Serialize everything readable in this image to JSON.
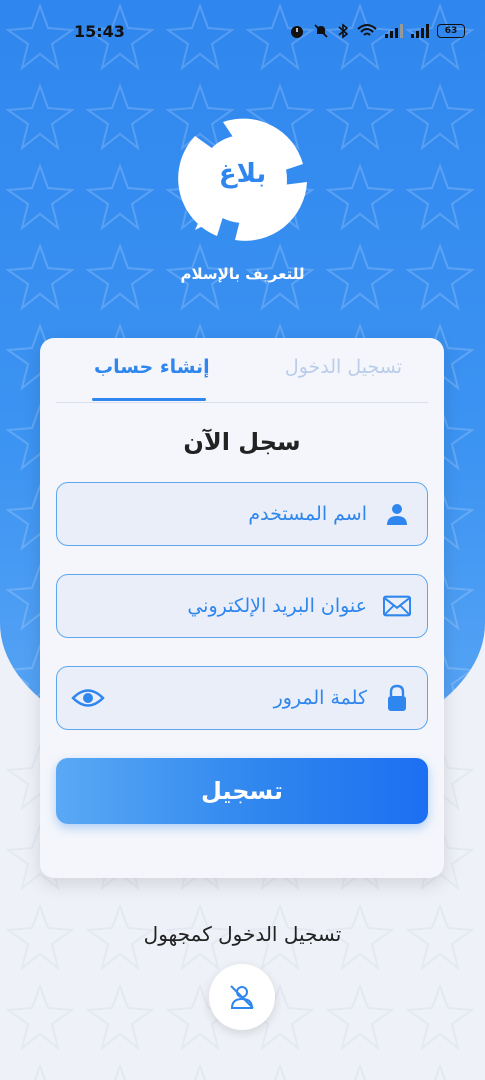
{
  "status_bar": {
    "time": "15:43",
    "battery": "63",
    "icons": [
      "alarm-icon",
      "mute-icon",
      "bluetooth-icon",
      "wifi-icon",
      "signal-icon",
      "signal-icon",
      "battery-icon"
    ]
  },
  "brand": {
    "logo_text": "بلاغ",
    "tagline": "للتعريف بالإسلام",
    "color": "#2f86ee"
  },
  "tabs": {
    "login": "تسجيل الدخول",
    "register": "إنشاء حساب",
    "active": "register"
  },
  "form": {
    "title": "سجل الآن",
    "username_placeholder": "اسم المستخدم",
    "email_placeholder": "عنوان البريد الإلكتروني",
    "password_placeholder": "كلمة المرور",
    "submit_label": "تسجيل"
  },
  "guest": {
    "label": "تسجيل الدخول كمجهول",
    "icon": "anonymous-user-icon"
  }
}
